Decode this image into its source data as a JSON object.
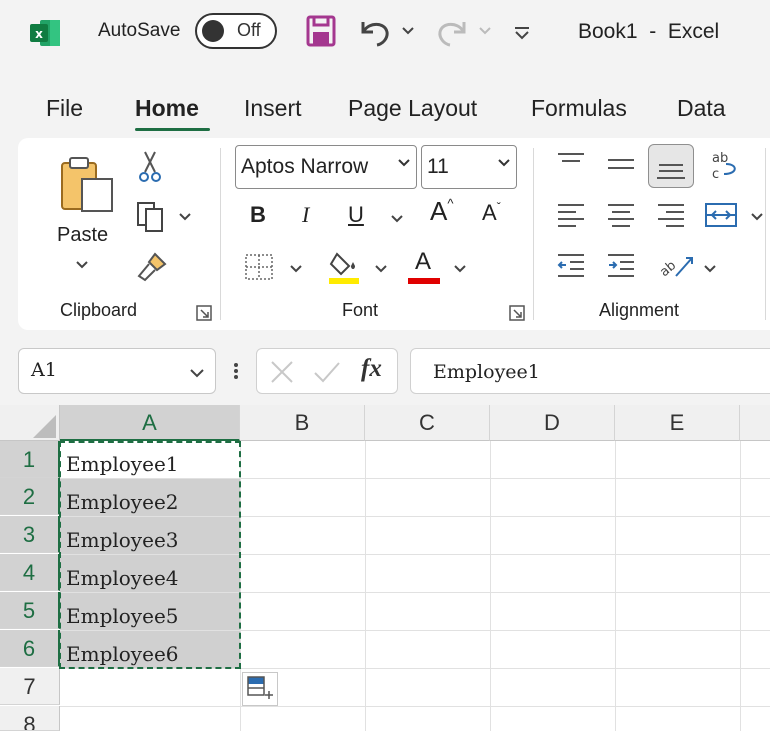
{
  "titlebar": {
    "autosave_label": "AutoSave",
    "autosave_state": "Off",
    "book_title": "Book1  -  Excel"
  },
  "tabs": [
    "File",
    "Home",
    "Insert",
    "Page Layout",
    "Formulas",
    "Data"
  ],
  "active_tab": "Home",
  "ribbon": {
    "clipboard": {
      "paste_label": "Paste",
      "group_label": "Clipboard"
    },
    "font": {
      "font_name": "Aptos Narrow",
      "font_size": "11",
      "group_label": "Font",
      "bold": "B",
      "italic": "I",
      "underline": "U",
      "grow": "A",
      "shrink": "A",
      "font_color_letter": "A",
      "highlight_color": "#ffeb00",
      "font_color": "#e00000"
    },
    "alignment": {
      "group_label": "Alignment"
    }
  },
  "formula_bar": {
    "name_box": "A1",
    "fx": "fx",
    "formula": "Employee1"
  },
  "grid": {
    "columns": [
      "A",
      "B",
      "C",
      "D",
      "E"
    ],
    "rows": [
      "1",
      "2",
      "3",
      "4",
      "5",
      "6",
      "7",
      "8"
    ],
    "cells": [
      "Employee1",
      "Employee2",
      "Employee3",
      "Employee4",
      "Employee5",
      "Employee6"
    ]
  },
  "colors": {
    "accent": "#1e6e43",
    "excel_green": "#107c41",
    "save_purple": "#a4378f"
  }
}
